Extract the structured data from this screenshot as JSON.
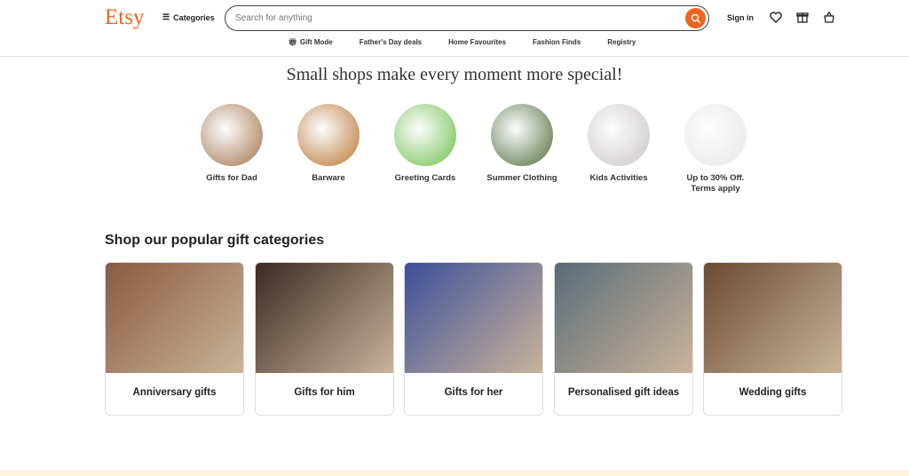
{
  "header": {
    "logo": "Etsy",
    "categories": "Categories",
    "search_placeholder": "Search for anything",
    "sign_in": "Sign in"
  },
  "nav": [
    "Gift Mode",
    "Father's Day deals",
    "Home Favourites",
    "Fashion Finds",
    "Registry"
  ],
  "headline": "Small shops make every moment more special!",
  "circles": [
    {
      "label": "Gifts for Dad",
      "color": "#a0724a"
    },
    {
      "label": "Barware",
      "color": "#b8732e"
    },
    {
      "label": "Greeting Cards",
      "color": "#6cbf4a"
    },
    {
      "label": "Summer Clothing",
      "color": "#4f6a3a"
    },
    {
      "label": "Kids Activities",
      "color": "#c9c4c8"
    },
    {
      "label": "Up to 30% Off. Terms apply",
      "color": "#e8e6e6"
    }
  ],
  "section_title": "Shop our popular gift categories",
  "cards": [
    {
      "label": "Anniversary gifts",
      "color": "#8a5a40"
    },
    {
      "label": "Gifts for him",
      "color": "#3a2a22"
    },
    {
      "label": "Gifts for her",
      "color": "#3d4f9a"
    },
    {
      "label": "Personalised gift ideas",
      "color": "#5a6b78"
    },
    {
      "label": "Wedding gifts",
      "color": "#6b4a32"
    }
  ],
  "accent": "#f1641e"
}
